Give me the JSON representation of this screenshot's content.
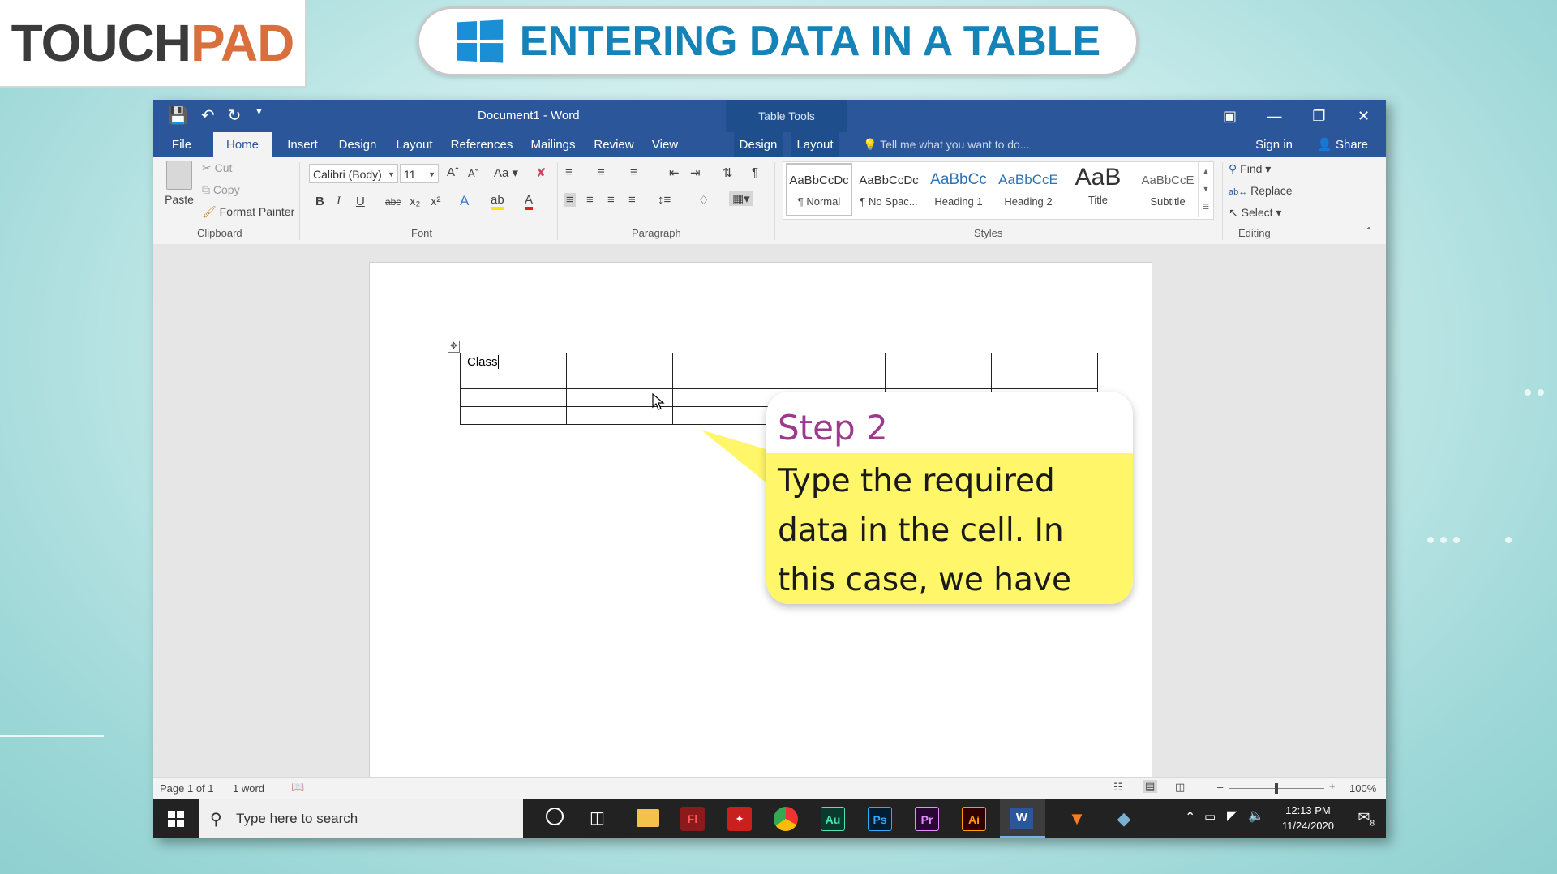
{
  "logo": {
    "part1": "TOUCH",
    "part2": "PAD"
  },
  "banner": {
    "title": "ENTERING DATA IN A TABLE"
  },
  "word": {
    "doc_title": "Document1 - Word",
    "table_tools": "Table Tools",
    "tabs": [
      "File",
      "Home",
      "Insert",
      "Design",
      "Layout",
      "References",
      "Mailings",
      "Review",
      "View",
      "Design",
      "Layout"
    ],
    "tell_me": "Tell me what you want to do...",
    "sign_in": "Sign in",
    "share": "Share",
    "clipboard": {
      "paste": "Paste",
      "cut": "Cut",
      "copy": "Copy",
      "format_painter": "Format Painter",
      "label": "Clipboard"
    },
    "font": {
      "name": "Calibri (Body)",
      "size": "11",
      "label": "Font",
      "case": "Aa"
    },
    "paragraph": {
      "label": "Paragraph"
    },
    "styles": {
      "label": "Styles",
      "items": [
        {
          "preview": "AaBbCcDc",
          "name": "¶ Normal"
        },
        {
          "preview": "AaBbCcDc",
          "name": "¶ No Spac..."
        },
        {
          "preview": "AaBbCc",
          "name": "Heading 1"
        },
        {
          "preview": "AaBbCcE",
          "name": "Heading 2"
        },
        {
          "preview": "AaB",
          "name": "Title"
        },
        {
          "preview": "AaBbCcE",
          "name": "Subtitle"
        }
      ]
    },
    "editing": {
      "find": "Find",
      "replace": "Replace",
      "select": "Select",
      "label": "Editing"
    },
    "table": {
      "rows": 4,
      "cols": 6,
      "cell_text": "Class"
    },
    "status": {
      "page": "Page 1 of 1",
      "words": "1 word",
      "zoom": "100%"
    }
  },
  "taskbar": {
    "search_placeholder": "Type here to search",
    "time": "12:13 PM",
    "date": "11/24/2020",
    "apps": [
      "Fl",
      "Au",
      "Ps",
      "Pr",
      "Ai"
    ],
    "notifications": "8"
  },
  "callout": {
    "heading": "Step 2",
    "text": "Type the required data in the cell. In this case, we have typed 'Class'."
  }
}
